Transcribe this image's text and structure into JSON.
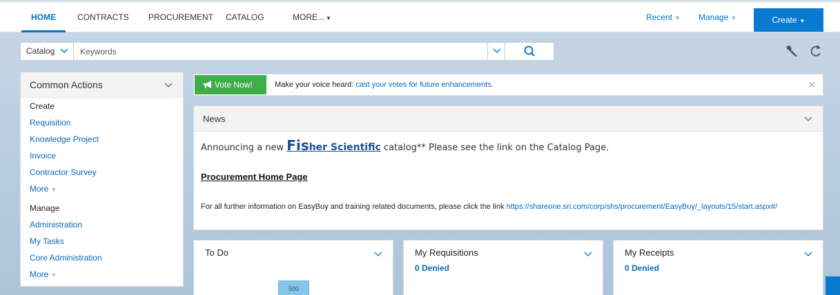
{
  "nav": {
    "tabs": [
      {
        "label": "HOME",
        "active": true
      },
      {
        "label": "CONTRACTS",
        "active": false
      },
      {
        "label": "PROCUREMENT",
        "active": false
      },
      {
        "label": "CATALOG",
        "active": false
      },
      {
        "label": "MORE...",
        "active": false
      }
    ],
    "recent_label": "Recent",
    "manage_label": "Manage",
    "create_label": "Create"
  },
  "search": {
    "category": "Catalog",
    "placeholder": "Keywords"
  },
  "common_actions": {
    "title": "Common Actions",
    "create_heading": "Create",
    "create_items": [
      "Requisition",
      "Knowledge Project",
      "Invoice",
      "Contractor Survey"
    ],
    "more_label": "More",
    "manage_heading": "Manage",
    "manage_items": [
      "Administration",
      "My Tasks",
      "Core Administration"
    ],
    "more_label_2": "More"
  },
  "vote": {
    "button_label": "Vote Now!",
    "text": "Make your voice heard:",
    "link_text": "cast your votes for future enhancements."
  },
  "news": {
    "title": "News",
    "announce_prefix": "Announcing a new",
    "fisher_big": "Fis",
    "fisher_rest": "her Scientific",
    "announce_suffix": "catalog** Please see the link on the Catalog Page.",
    "procurement_link": "Procurement Home Page",
    "further_text": "For all further information on EasyBuy and training related documents, please click the link",
    "further_link": "https://shareone.sri.com/corp/shs/procurement/EasyBuy/_layouts/15/start.aspx#/"
  },
  "widgets": {
    "todo": {
      "title": "To Do",
      "bar_label": "500"
    },
    "requisitions": {
      "title": "My Requisitions",
      "sub": "0 Denied"
    },
    "receipts": {
      "title": "My Receipts",
      "sub": "0 Denied"
    }
  },
  "colors": {
    "accent": "#0073c7",
    "create_button": "#0a7ad1",
    "vote_green": "#3fae4a",
    "link": "#0a6ab8"
  }
}
